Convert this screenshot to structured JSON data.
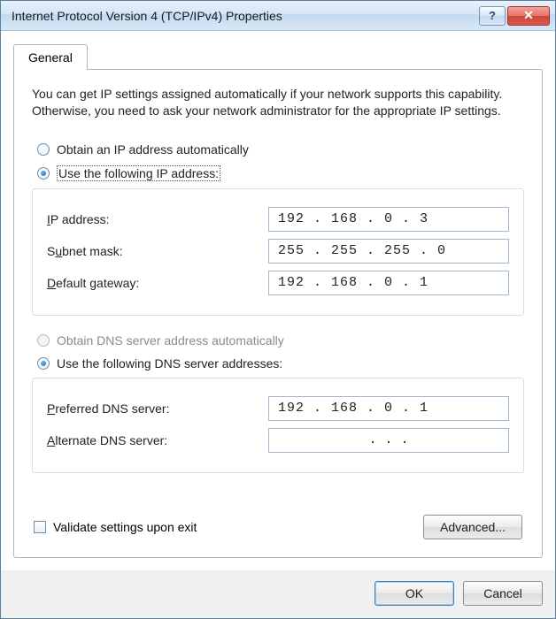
{
  "window": {
    "title": "Internet Protocol Version 4 (TCP/IPv4) Properties"
  },
  "tabs": {
    "general": "General"
  },
  "description": "You can get IP settings assigned automatically if your network supports this capability. Otherwise, you need to ask your network administrator for the appropriate IP settings.",
  "ip_section": {
    "radio_auto": "btain an IP address automatically",
    "radio_auto_ul": "O",
    "radio_manual": "se the following IP address:",
    "radio_manual_ul": "U",
    "selected": "manual",
    "fields": {
      "ip_address": {
        "label_pre": "",
        "label_ul": "I",
        "label_post": "P address:",
        "value": "192 . 168 .  0 .  3"
      },
      "subnet": {
        "label_pre": "S",
        "label_ul": "u",
        "label_post": "bnet mask:",
        "value": "255 . 255 . 255 . 0"
      },
      "gateway": {
        "label_pre": "",
        "label_ul": "D",
        "label_post": "efault gateway:",
        "value": "192 . 168 .  0 .  1"
      }
    }
  },
  "dns_section": {
    "radio_auto": "tain DNS server address automatically",
    "radio_auto_pre": "O",
    "radio_auto_ul": "b",
    "radio_manual_pre": "Us",
    "radio_manual_ul": "e",
    "radio_manual": " the following DNS server addresses:",
    "disabled_auto": true,
    "selected": "manual",
    "fields": {
      "preferred": {
        "label_pre": "",
        "label_ul": "P",
        "label_post": "referred DNS server:",
        "value": "192 . 168 .  0 .  1"
      },
      "alternate": {
        "label_pre": "",
        "label_ul": "A",
        "label_post": "lternate DNS server:",
        "value": "  .     .     ."
      }
    }
  },
  "validate": {
    "label_pre": "Va",
    "label_ul": "l",
    "label_post": "idate settings upon exit",
    "checked": false
  },
  "buttons": {
    "advanced": "Ad",
    "advanced_ul": "v",
    "advanced_post": "anced...",
    "ok": "OK",
    "cancel": "Cancel"
  }
}
